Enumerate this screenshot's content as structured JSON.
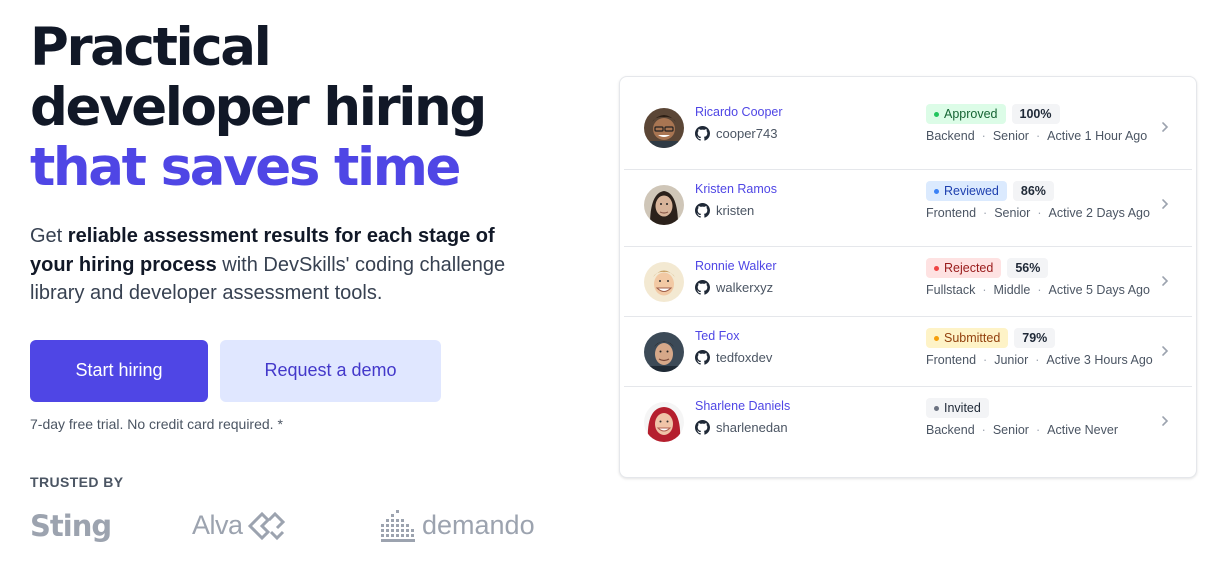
{
  "hero": {
    "headline_line1": "Practical",
    "headline_line2": "developer hiring",
    "headline_accent": "that saves time",
    "lede_prefix": "Get ",
    "lede_bold": "reliable assessment results for each stage of your hiring process",
    "lede_suffix": " with DevSkills' coding challenge library and developer assessment tools.",
    "primary_cta": "Start hiring",
    "secondary_cta": "Request a demo",
    "trial_note": "7-day free trial. No credit card required. *"
  },
  "trusted": {
    "title": "TRUSTED BY",
    "logos": [
      "Sting",
      "Alva",
      "demando"
    ]
  },
  "colors": {
    "brand": "#4f46e5",
    "brand_light": "#e0e7ff",
    "approved": "#22c55e",
    "reviewed": "#3b82f6",
    "rejected": "#ef4444",
    "submitted": "#f59e0b",
    "invited": "#6b7280"
  },
  "candidates": [
    {
      "name": "Ricardo Cooper",
      "username": "cooper743",
      "status": "Approved",
      "score": "100%",
      "role": "Backend",
      "level": "Senior",
      "activity": "Active 1 Hour Ago"
    },
    {
      "name": "Kristen Ramos",
      "username": "kristen",
      "status": "Reviewed",
      "score": "86%",
      "role": "Frontend",
      "level": "Senior",
      "activity": "Active 2 Days Ago"
    },
    {
      "name": "Ronnie Walker",
      "username": "walkerxyz",
      "status": "Rejected",
      "score": "56%",
      "role": "Fullstack",
      "level": "Middle",
      "activity": "Active 5 Days Ago"
    },
    {
      "name": "Ted Fox",
      "username": "tedfoxdev",
      "status": "Submitted",
      "score": "79%",
      "role": "Frontend",
      "level": "Junior",
      "activity": "Active 3 Hours Ago"
    },
    {
      "name": "Sharlene Daniels",
      "username": "sharlenedan",
      "status": "Invited",
      "score": "",
      "role": "Backend",
      "level": "Senior",
      "activity": "Active Never"
    }
  ],
  "icons": {
    "github": "github-icon",
    "chevron": "chevron-right-icon",
    "status_dot": "status-dot-icon"
  },
  "separator": "·"
}
